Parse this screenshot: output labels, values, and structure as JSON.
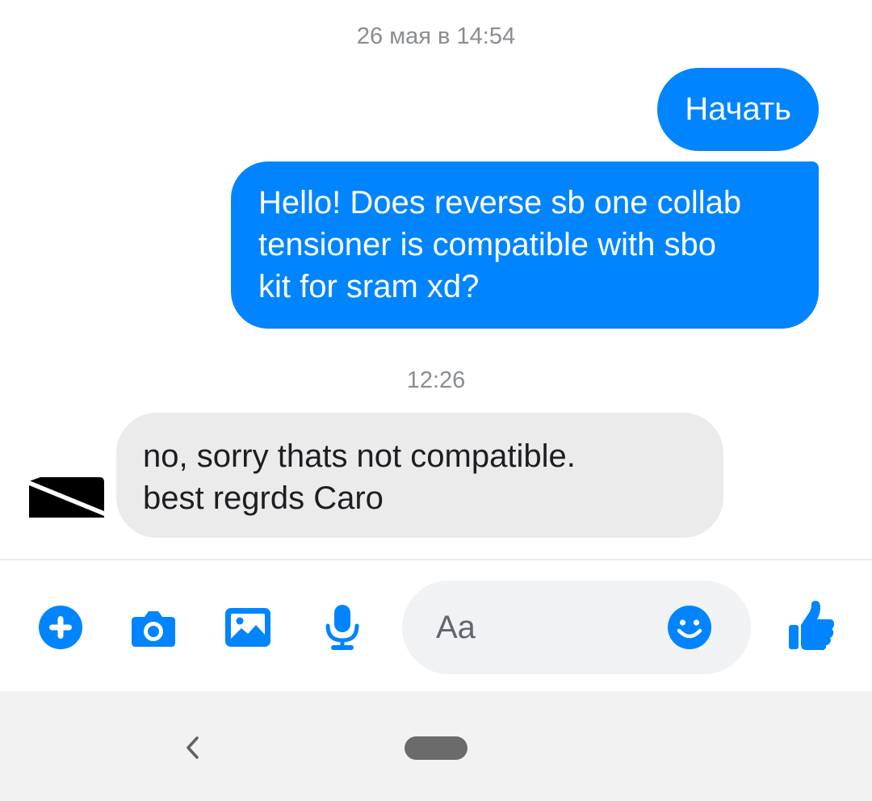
{
  "thread": {
    "timestamp_1": "26 мая в 14:54",
    "timestamp_2": "12:26",
    "messages": [
      {
        "from": "me",
        "text": "Начать"
      },
      {
        "from": "me",
        "text": "Hello! Does reverse sb one collab\ntensioner is compatible with sbo\nkit for sram xd?"
      },
      {
        "from": "them",
        "text": "no, sorry thats not compatible.\nbest regrds Caro"
      }
    ]
  },
  "composer": {
    "placeholder": "Aa",
    "value": "",
    "tools": [
      "plus-circle-icon",
      "camera-icon",
      "image-icon",
      "microphone-icon"
    ],
    "emoji_icon": "smiley-icon",
    "send_icon": "thumbs-up-icon"
  },
  "colors": {
    "accent": "#0084ff",
    "outgoing_bubble": "#0084ff",
    "incoming_bubble": "#ebebeb",
    "timestamp": "#8a8d91",
    "navbar": "#f2f2f2"
  }
}
